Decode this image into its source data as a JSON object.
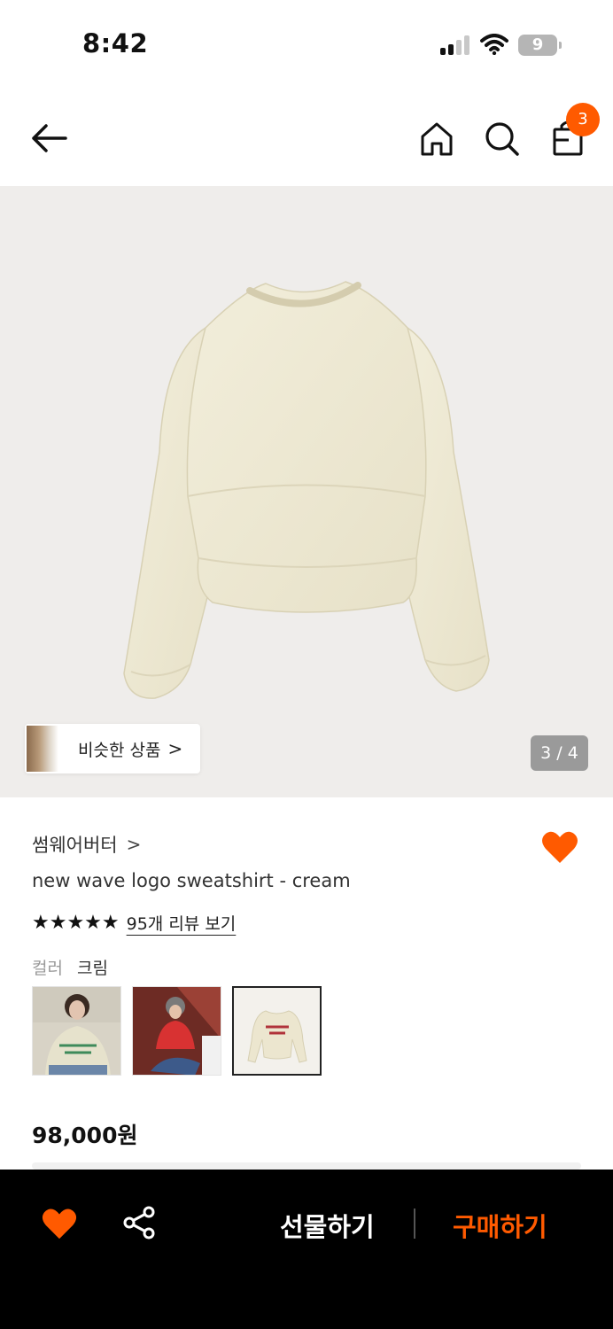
{
  "status_bar": {
    "time": "8:42",
    "battery": "9"
  },
  "header": {
    "back_icon": "arrow-left-icon",
    "home_icon": "home-icon",
    "search_icon": "search-icon",
    "bag_icon": "shopping-bag-icon",
    "bag_count": "3"
  },
  "hero": {
    "similar_label": "비슷한 상품",
    "similar_chevron": ">",
    "page_indicator": "3 / 4"
  },
  "product": {
    "brand": "썸웨어버터",
    "brand_chevron": ">",
    "name": "new wave logo sweatshirt - cream",
    "rating_stars": "★★★★★",
    "review_link": "95개 리뷰 보기",
    "color_label": "컬러",
    "color_value": "크림",
    "price": "98,000원"
  },
  "bottom_bar": {
    "gift_label": "선물하기",
    "buy_label": "구매하기"
  },
  "colors": {
    "accent": "#ff5a00",
    "bottom_bar_bg": "#000000",
    "hero_bg": "#efedeb"
  }
}
